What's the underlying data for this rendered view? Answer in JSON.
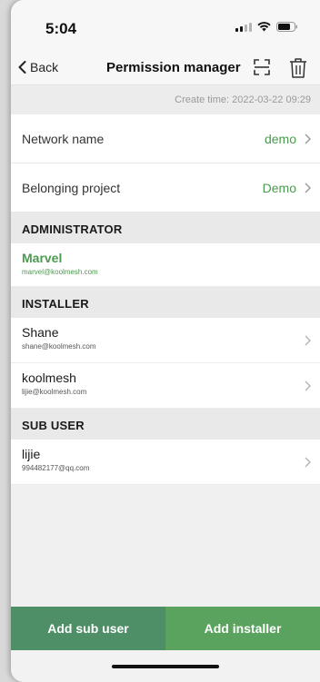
{
  "status_bar": {
    "time": "5:04"
  },
  "nav": {
    "back_label": "Back",
    "title": "Permission manager",
    "scan_icon": "scan-icon",
    "delete_icon": "trash-icon"
  },
  "create_time": "Create time: 2022-03-22 09:29",
  "fields": [
    {
      "label": "Network name",
      "value": "demo"
    },
    {
      "label": "Belonging project",
      "value": "Demo"
    }
  ],
  "administrator": {
    "header": "ADMINISTRATOR",
    "name": "Marvel",
    "email": "marvel@koolmesh.com"
  },
  "installer": {
    "header": "INSTALLER",
    "users": [
      {
        "name": "Shane",
        "email": "shane@koolmesh.com"
      },
      {
        "name": "koolmesh",
        "email": "lijie@koolmesh.com"
      }
    ]
  },
  "sub_user": {
    "header": "SUB USER",
    "users": [
      {
        "name": "lijie",
        "email": "994482177@qq.com"
      }
    ]
  },
  "buttons": {
    "add_sub_user": "Add sub user",
    "add_installer": "Add installer"
  },
  "colors": {
    "accent_green": "#4a9a4f",
    "add_sub_user_bg": "#4e8f68",
    "add_installer_bg": "#5aa35f"
  }
}
